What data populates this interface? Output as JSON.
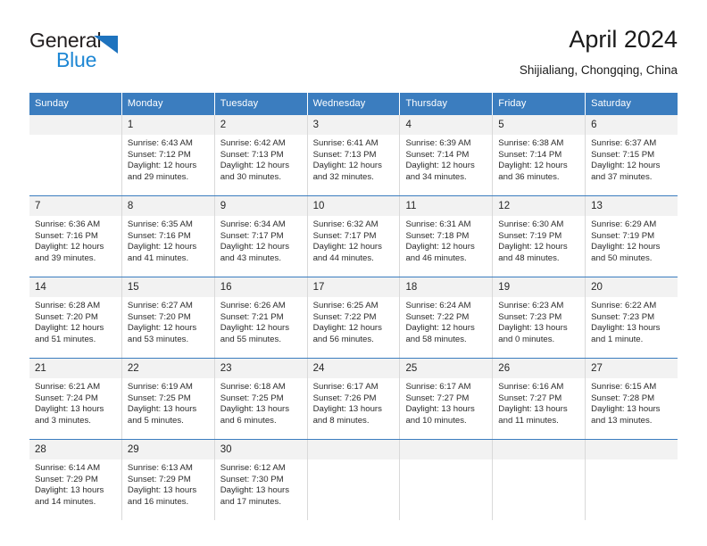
{
  "brand": {
    "name_top": "General",
    "name_bottom": "Blue",
    "color_dark": "#231f20",
    "color_blue": "#1e87d4"
  },
  "header": {
    "title": "April 2024",
    "subtitle": "Shijialiang, Chongqing, China"
  },
  "theme": {
    "header_blue": "#3b7dbf",
    "day_band": "#f2f2f2",
    "cell_border": "#d9d9d9"
  },
  "weekdays": [
    "Sunday",
    "Monday",
    "Tuesday",
    "Wednesday",
    "Thursday",
    "Friday",
    "Saturday"
  ],
  "weeks": [
    [
      {
        "day": "",
        "sunrise": "",
        "sunset": "",
        "daylight1": "",
        "daylight2": "",
        "empty": true
      },
      {
        "day": "1",
        "sunrise": "Sunrise: 6:43 AM",
        "sunset": "Sunset: 7:12 PM",
        "daylight1": "Daylight: 12 hours",
        "daylight2": "and 29 minutes."
      },
      {
        "day": "2",
        "sunrise": "Sunrise: 6:42 AM",
        "sunset": "Sunset: 7:13 PM",
        "daylight1": "Daylight: 12 hours",
        "daylight2": "and 30 minutes."
      },
      {
        "day": "3",
        "sunrise": "Sunrise: 6:41 AM",
        "sunset": "Sunset: 7:13 PM",
        "daylight1": "Daylight: 12 hours",
        "daylight2": "and 32 minutes."
      },
      {
        "day": "4",
        "sunrise": "Sunrise: 6:39 AM",
        "sunset": "Sunset: 7:14 PM",
        "daylight1": "Daylight: 12 hours",
        "daylight2": "and 34 minutes."
      },
      {
        "day": "5",
        "sunrise": "Sunrise: 6:38 AM",
        "sunset": "Sunset: 7:14 PM",
        "daylight1": "Daylight: 12 hours",
        "daylight2": "and 36 minutes."
      },
      {
        "day": "6",
        "sunrise": "Sunrise: 6:37 AM",
        "sunset": "Sunset: 7:15 PM",
        "daylight1": "Daylight: 12 hours",
        "daylight2": "and 37 minutes."
      }
    ],
    [
      {
        "day": "7",
        "sunrise": "Sunrise: 6:36 AM",
        "sunset": "Sunset: 7:16 PM",
        "daylight1": "Daylight: 12 hours",
        "daylight2": "and 39 minutes."
      },
      {
        "day": "8",
        "sunrise": "Sunrise: 6:35 AM",
        "sunset": "Sunset: 7:16 PM",
        "daylight1": "Daylight: 12 hours",
        "daylight2": "and 41 minutes."
      },
      {
        "day": "9",
        "sunrise": "Sunrise: 6:34 AM",
        "sunset": "Sunset: 7:17 PM",
        "daylight1": "Daylight: 12 hours",
        "daylight2": "and 43 minutes."
      },
      {
        "day": "10",
        "sunrise": "Sunrise: 6:32 AM",
        "sunset": "Sunset: 7:17 PM",
        "daylight1": "Daylight: 12 hours",
        "daylight2": "and 44 minutes."
      },
      {
        "day": "11",
        "sunrise": "Sunrise: 6:31 AM",
        "sunset": "Sunset: 7:18 PM",
        "daylight1": "Daylight: 12 hours",
        "daylight2": "and 46 minutes."
      },
      {
        "day": "12",
        "sunrise": "Sunrise: 6:30 AM",
        "sunset": "Sunset: 7:19 PM",
        "daylight1": "Daylight: 12 hours",
        "daylight2": "and 48 minutes."
      },
      {
        "day": "13",
        "sunrise": "Sunrise: 6:29 AM",
        "sunset": "Sunset: 7:19 PM",
        "daylight1": "Daylight: 12 hours",
        "daylight2": "and 50 minutes."
      }
    ],
    [
      {
        "day": "14",
        "sunrise": "Sunrise: 6:28 AM",
        "sunset": "Sunset: 7:20 PM",
        "daylight1": "Daylight: 12 hours",
        "daylight2": "and 51 minutes."
      },
      {
        "day": "15",
        "sunrise": "Sunrise: 6:27 AM",
        "sunset": "Sunset: 7:20 PM",
        "daylight1": "Daylight: 12 hours",
        "daylight2": "and 53 minutes."
      },
      {
        "day": "16",
        "sunrise": "Sunrise: 6:26 AM",
        "sunset": "Sunset: 7:21 PM",
        "daylight1": "Daylight: 12 hours",
        "daylight2": "and 55 minutes."
      },
      {
        "day": "17",
        "sunrise": "Sunrise: 6:25 AM",
        "sunset": "Sunset: 7:22 PM",
        "daylight1": "Daylight: 12 hours",
        "daylight2": "and 56 minutes."
      },
      {
        "day": "18",
        "sunrise": "Sunrise: 6:24 AM",
        "sunset": "Sunset: 7:22 PM",
        "daylight1": "Daylight: 12 hours",
        "daylight2": "and 58 minutes."
      },
      {
        "day": "19",
        "sunrise": "Sunrise: 6:23 AM",
        "sunset": "Sunset: 7:23 PM",
        "daylight1": "Daylight: 13 hours",
        "daylight2": "and 0 minutes."
      },
      {
        "day": "20",
        "sunrise": "Sunrise: 6:22 AM",
        "sunset": "Sunset: 7:23 PM",
        "daylight1": "Daylight: 13 hours",
        "daylight2": "and 1 minute."
      }
    ],
    [
      {
        "day": "21",
        "sunrise": "Sunrise: 6:21 AM",
        "sunset": "Sunset: 7:24 PM",
        "daylight1": "Daylight: 13 hours",
        "daylight2": "and 3 minutes."
      },
      {
        "day": "22",
        "sunrise": "Sunrise: 6:19 AM",
        "sunset": "Sunset: 7:25 PM",
        "daylight1": "Daylight: 13 hours",
        "daylight2": "and 5 minutes."
      },
      {
        "day": "23",
        "sunrise": "Sunrise: 6:18 AM",
        "sunset": "Sunset: 7:25 PM",
        "daylight1": "Daylight: 13 hours",
        "daylight2": "and 6 minutes."
      },
      {
        "day": "24",
        "sunrise": "Sunrise: 6:17 AM",
        "sunset": "Sunset: 7:26 PM",
        "daylight1": "Daylight: 13 hours",
        "daylight2": "and 8 minutes."
      },
      {
        "day": "25",
        "sunrise": "Sunrise: 6:17 AM",
        "sunset": "Sunset: 7:27 PM",
        "daylight1": "Daylight: 13 hours",
        "daylight2": "and 10 minutes."
      },
      {
        "day": "26",
        "sunrise": "Sunrise: 6:16 AM",
        "sunset": "Sunset: 7:27 PM",
        "daylight1": "Daylight: 13 hours",
        "daylight2": "and 11 minutes."
      },
      {
        "day": "27",
        "sunrise": "Sunrise: 6:15 AM",
        "sunset": "Sunset: 7:28 PM",
        "daylight1": "Daylight: 13 hours",
        "daylight2": "and 13 minutes."
      }
    ],
    [
      {
        "day": "28",
        "sunrise": "Sunrise: 6:14 AM",
        "sunset": "Sunset: 7:29 PM",
        "daylight1": "Daylight: 13 hours",
        "daylight2": "and 14 minutes."
      },
      {
        "day": "29",
        "sunrise": "Sunrise: 6:13 AM",
        "sunset": "Sunset: 7:29 PM",
        "daylight1": "Daylight: 13 hours",
        "daylight2": "and 16 minutes."
      },
      {
        "day": "30",
        "sunrise": "Sunrise: 6:12 AM",
        "sunset": "Sunset: 7:30 PM",
        "daylight1": "Daylight: 13 hours",
        "daylight2": "and 17 minutes."
      },
      {
        "day": "",
        "sunrise": "",
        "sunset": "",
        "daylight1": "",
        "daylight2": "",
        "empty": true
      },
      {
        "day": "",
        "sunrise": "",
        "sunset": "",
        "daylight1": "",
        "daylight2": "",
        "empty": true
      },
      {
        "day": "",
        "sunrise": "",
        "sunset": "",
        "daylight1": "",
        "daylight2": "",
        "empty": true
      },
      {
        "day": "",
        "sunrise": "",
        "sunset": "",
        "daylight1": "",
        "daylight2": "",
        "empty": true
      }
    ]
  ]
}
